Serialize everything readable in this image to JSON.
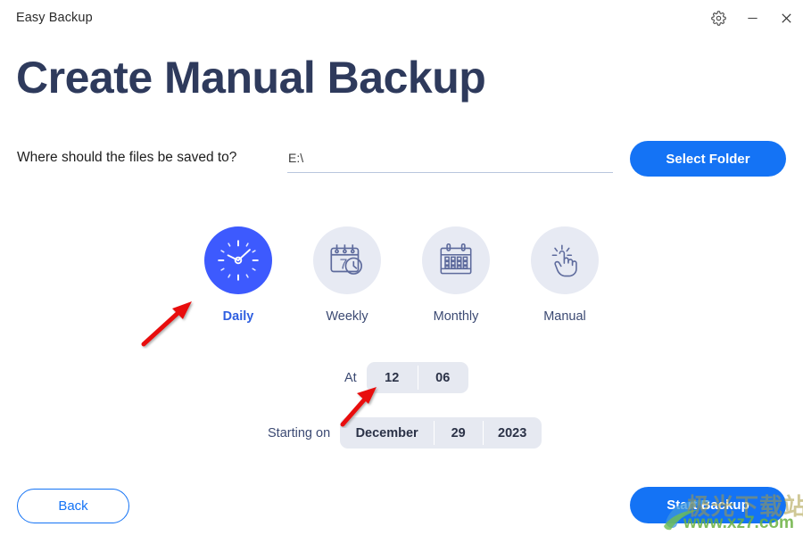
{
  "window": {
    "app_title": "Easy Backup",
    "controls": [
      {
        "name": "settings-button",
        "icon": "gear-icon"
      },
      {
        "name": "minimize-button",
        "icon": "minimize-icon"
      },
      {
        "name": "close-button",
        "icon": "close-icon"
      }
    ]
  },
  "page": {
    "title": "Create Manual Backup"
  },
  "destination": {
    "label": "Where should the files be saved to?",
    "input_value": "E:\\",
    "input_placeholder": "",
    "select_folder_label": "Select Folder"
  },
  "schedule": {
    "options": [
      {
        "label": "Daily",
        "icon": "clock-icon",
        "active": true
      },
      {
        "label": "Weekly",
        "icon": "calendar-week-icon",
        "active": false
      },
      {
        "label": "Monthly",
        "icon": "calendar-month-icon",
        "active": false
      },
      {
        "label": "Manual",
        "icon": "hand-tap-icon",
        "active": false
      }
    ]
  },
  "time_picker": {
    "label": "At",
    "hour": "12",
    "minute": "06"
  },
  "date_picker": {
    "label": "Starting on",
    "month": "December",
    "day": "29",
    "year": "2023"
  },
  "footer": {
    "back_label": "Back",
    "start_label": "Start Backup"
  },
  "watermark": {
    "site_name": "极光下载站",
    "url": "www.xz7.com"
  },
  "colors": {
    "accent_blue": "#1473f5",
    "active_icon_blue": "#3d5afe",
    "heading_navy": "#2e3a5c",
    "inactive_circle": "#e7eaf3",
    "picker_bg": "#e6e9f1",
    "annotation_red": "#e81010"
  }
}
